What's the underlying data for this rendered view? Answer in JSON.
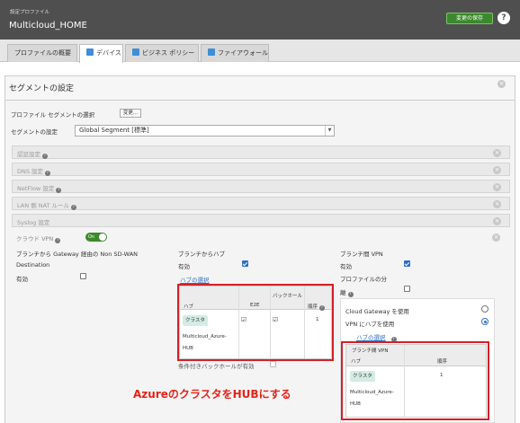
{
  "header": {
    "breadcrumb": "設定プロファイル",
    "title": "Multicloud_HOME",
    "save_label": "変更の保存",
    "help_label": "?"
  },
  "tabs": [
    {
      "label": "プロファイルの概要"
    },
    {
      "label": "デバイス",
      "active": true,
      "icon": "device-icon"
    },
    {
      "label": "ビジネス ポリシー",
      "icon": "policy-icon"
    },
    {
      "label": "ファイアウォール",
      "icon": "firewall-icon"
    }
  ],
  "segment": {
    "section_title": "セグメントの設定",
    "select_label": "プロファイル セグメントの選択",
    "change_button": "変更...",
    "setting_label": "セグメントの設定",
    "setting_value": "Global Segment [標準]"
  },
  "collapsed_sections": [
    {
      "label": "認証設定",
      "info": true
    },
    {
      "label": "DNS 設定",
      "info": true
    },
    {
      "label": "NetFlow 設定",
      "info": true
    },
    {
      "label": "LAN 側 NAT ルール",
      "info": true
    },
    {
      "label": "Syslog 設定",
      "info": false
    }
  ],
  "cloud_vpn": {
    "label": "クラウド VPN",
    "toggle_label": "On",
    "toggle_on": true,
    "col1": {
      "title_line1": "ブランチから Gateway 経由の Non SD-WAN",
      "title_line2": "Destination",
      "enabled_label": "有効",
      "enabled": false
    },
    "col2": {
      "title": "ブランチからハブ",
      "enabled_label": "有効",
      "enabled": true,
      "hub_select_link": "ハブの選択",
      "table": {
        "headers": [
          "ハブ",
          "E2E",
          "バックホール",
          "順序"
        ],
        "rows": [
          {
            "hub_chip": "クラスタ",
            "hub_name": "Multicloud_Azure-HUB",
            "e2e": true,
            "backhaul": true,
            "order": "1"
          }
        ]
      },
      "conditional_backhaul_label": "条件付きバックホールが有効"
    },
    "col3": {
      "title": "ブランチ間 VPN",
      "enabled_label": "有効",
      "enabled": true,
      "profile_isolation_label_1": "プロファイルの分",
      "profile_isolation_label_2": "離",
      "profile_isolation": false,
      "use_cloud_gateway_label": "Cloud Gateway を使用",
      "use_hub_label": "VPN にハブを使用",
      "hub_select_link": "ハブの選択",
      "table": {
        "caption": "ブランチ間 VPN",
        "headers": [
          "ハブ",
          "順序"
        ],
        "rows": [
          {
            "hub_chip": "クラスタ",
            "hub_name": "Multicloud_Azure-HUB",
            "order": "1"
          }
        ]
      }
    }
  },
  "annotation": "AzureのクラスタをHUBにする",
  "colors": {
    "header_bg": "#4f4f4f",
    "save_green": "#3a8a2b",
    "highlight_red": "#d61f26",
    "link_blue": "#2f6fc4",
    "chip_bg": "#d3ece4"
  }
}
